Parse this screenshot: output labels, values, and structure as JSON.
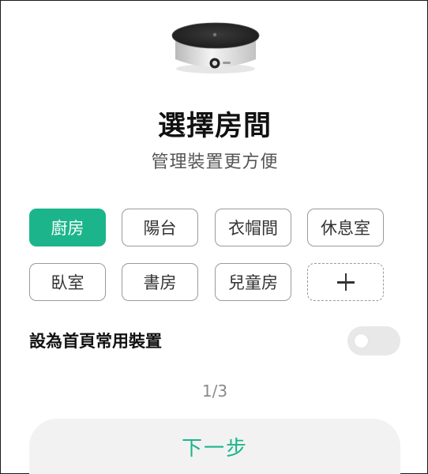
{
  "header": {
    "title": "選擇房間",
    "subtitle": "管理裝置更方便",
    "device_icon": "induction-cooktop-icon"
  },
  "rooms": [
    {
      "label": "廚房",
      "selected": true
    },
    {
      "label": "陽台",
      "selected": false
    },
    {
      "label": "衣帽間",
      "selected": false
    },
    {
      "label": "休息室",
      "selected": false
    },
    {
      "label": "臥室",
      "selected": false
    },
    {
      "label": "書房",
      "selected": false
    },
    {
      "label": "兒童房",
      "selected": false
    }
  ],
  "add_room_icon": "plus-icon",
  "home_toggle": {
    "label": "設為首頁常用裝置",
    "on": false
  },
  "pager": "1/3",
  "next_button": "下一步",
  "colors": {
    "accent": "#1cb58b",
    "toggle_off": "#e8e8e8",
    "button_bg": "#f2f2f2"
  }
}
